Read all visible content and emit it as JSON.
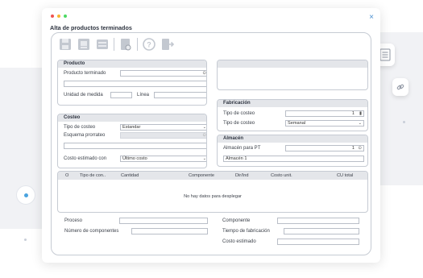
{
  "window": {
    "title": "Alta de productos terminados",
    "close": "×"
  },
  "colors": {
    "dot_red": "#ef5350",
    "dot_yellow": "#f7b731",
    "dot_green": "#4cd964",
    "accent": "#4a8fd0"
  },
  "toolbar": {
    "icons": [
      "save-icon",
      "save-as-icon",
      "form-icon",
      "preview-icon",
      "help-icon",
      "exit-icon"
    ]
  },
  "producto": {
    "header": "Producto",
    "producto_terminado_label": "Producto terminado",
    "unidad_label": "Unidad de medida",
    "linea_label": "Línea"
  },
  "costeo": {
    "header": "Costeo",
    "tipo_label": "Tipo de costeo",
    "tipo_value": "Estandar",
    "esquema_label": "Esquema prorrateo",
    "costo_label": "Costo estimado con",
    "costo_value": "Último costo"
  },
  "fabricacion": {
    "header": "Fabricación",
    "tipo_costeo_label": "Tipo de costeo",
    "tipo_costeo_value": "1",
    "tipo_costeo2_label": "Tipo de costeo",
    "tipo_costeo2_value": "Semanal"
  },
  "almacen": {
    "header": "Almacén",
    "almacen_pt_label": "Almacén para PT",
    "almacen_pt_value": "1",
    "almacen_name": "Almacén 1"
  },
  "table": {
    "columns": [
      "O",
      "Tipo de con..",
      "Cantidad",
      "Componente",
      "Dir/Ind",
      "Costo unit.",
      "CU total"
    ],
    "empty_message": "No hay datos para desplegar"
  },
  "footer": {
    "proceso_label": "Proceso",
    "num_componentes_label": "Número de componentes",
    "componente_label": "Componente",
    "tiempo_label": "Tiempo de fabricación",
    "costo_label": "Costo estimado"
  }
}
